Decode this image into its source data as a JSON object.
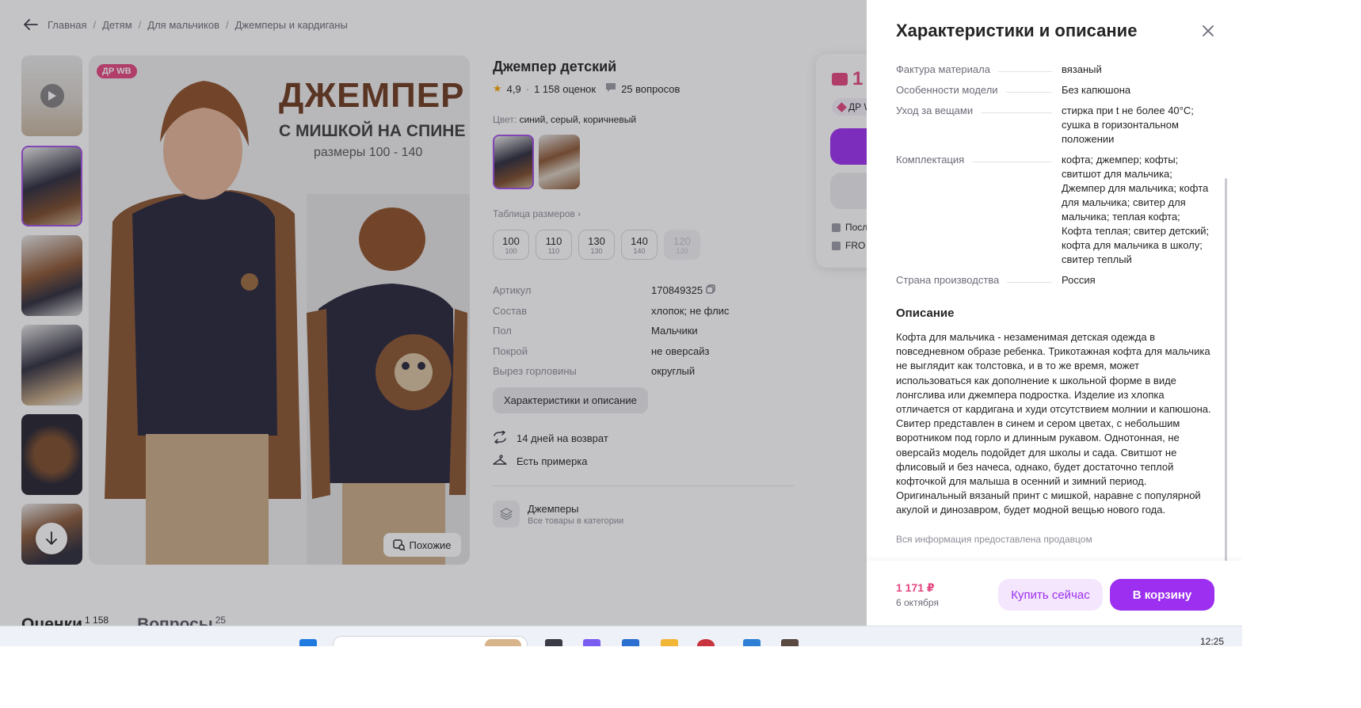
{
  "breadcrumbs": [
    "Главная",
    "Детям",
    "Для мальчиков",
    "Джемперы и кардиганы"
  ],
  "gallery": {
    "badge": "ДР WB",
    "headline": "ДЖЕМПЕР",
    "subheadline": "С МИШКОЙ НА СПИНЕ",
    "sizes_text": "размеры 100 - 140",
    "similar_label": "Похожие"
  },
  "product": {
    "title": "Джемпер детский",
    "rating": "4,9",
    "reviews": "1 158 оценок",
    "questions": "25 вопросов",
    "color_label": "Цвет:",
    "color_value": "синий, серый, коричневый",
    "size_table_label": "Таблица размеров",
    "sizes": [
      {
        "n": "100",
        "s": "100"
      },
      {
        "n": "110",
        "s": "110"
      },
      {
        "n": "130",
        "s": "130"
      },
      {
        "n": "140",
        "s": "140"
      },
      {
        "n": "120",
        "s": "120"
      }
    ],
    "params": [
      {
        "k": "Артикул",
        "v": "170849325"
      },
      {
        "k": "Состав",
        "v": "хлопок; не флис"
      },
      {
        "k": "Пол",
        "v": "Мальчики"
      },
      {
        "k": "Покрой",
        "v": "не оверсайз"
      },
      {
        "k": "Вырез горловины",
        "v": "округлый"
      }
    ],
    "char_button": "Характеристики и описание",
    "return_text": "14 дней на возврат",
    "fitting_text": "Есть примерка",
    "category_title": "Джемперы",
    "category_sub": "Все товары в категории"
  },
  "buycard": {
    "price_fragment": "1",
    "badge_fragment": "ДР W",
    "line1": "Посл",
    "line2": "FRO"
  },
  "bottom_tabs": {
    "reviews_label": "Оценки",
    "reviews_count": "1 158",
    "questions_label": "Вопросы",
    "questions_count": "25"
  },
  "panel": {
    "title": "Характеристики и описание",
    "chars": [
      {
        "k": "Фактура материала",
        "v": "вязаный"
      },
      {
        "k": "Особенности модели",
        "v": "Без капюшона"
      },
      {
        "k": "Уход за вещами",
        "v": "стирка при t не более 40°С; сушка в горизонтальном положении"
      },
      {
        "k": "Комплектация",
        "v": "кофта; джемпер; кофты; свитшот для мальчика; Джемпер для мальчика; кофта для мальчика; свитер для мальчика; теплая кофта; Кофта теплая; свитер детский; кофта для мальчика в школу; свитер теплый"
      },
      {
        "k": "Страна производства",
        "v": "Россия"
      }
    ],
    "description_title": "Описание",
    "description": "Кофта для мальчика - незаменимая детская одежда в повседневном образе ребенка. Трикотажная кофта для мальчика не выглядит как толстовка, и в то же время, может использоваться как дополнение к школьной форме в виде лонгслива или джемпера подростка. Изделие из хлопка отличается от кардигана и худи отсутствием молнии и капюшона. Свитер представлен в синем и сером цветах, с небольшим воротником под горло и длинным рукавом. Однотонная, не оверсайз модель подойдет для школы и сада. Свитшот не флисовый и без начеса, однако, будет достаточно теплой кофточкой для малыша в осенний и зимний период. Оригинальный вязаный принт с мишкой, наравне с популярной акулой и динозавром, будет модной вещью нового года.",
    "disclaimer": "Вся информация предоставлена продавцом",
    "footer_price": "1 171 ₽",
    "footer_date": "6 октября",
    "buy_now": "Купить сейчас",
    "add_to_cart": "В корзину"
  },
  "taskbar": {
    "clock": "12:25"
  },
  "colors": {
    "accent": "#9c2ff0",
    "price": "#e3467f",
    "text": "#242424",
    "muted": "#8d8d99"
  }
}
